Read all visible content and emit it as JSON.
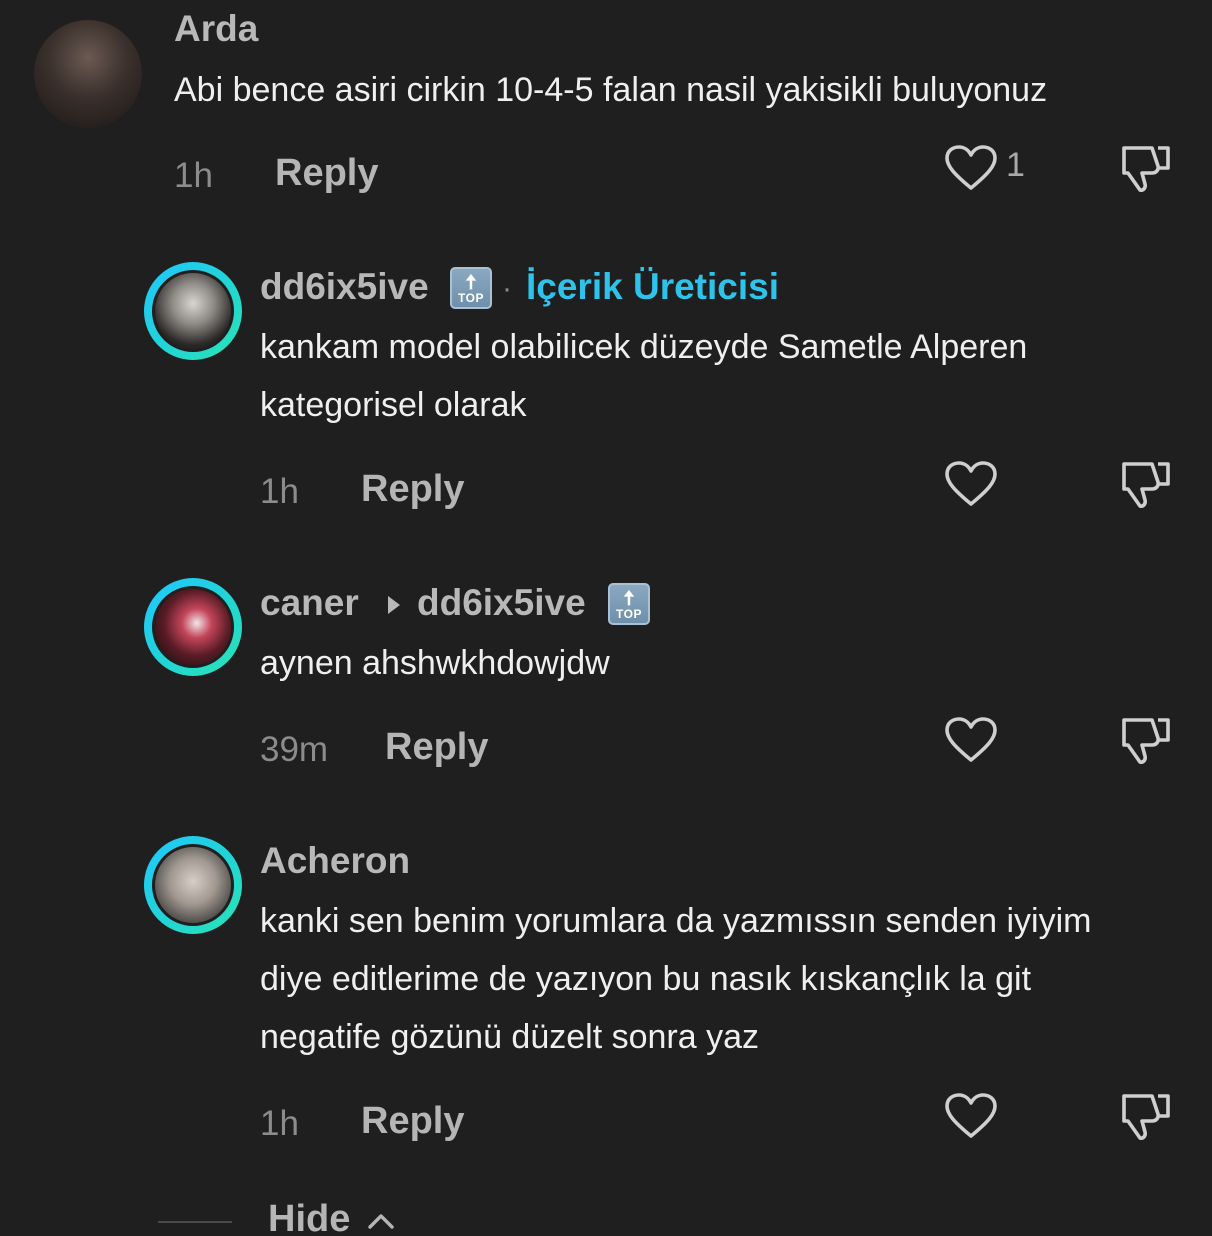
{
  "comments": [
    {
      "username": "Arda",
      "text": "Abi bence asiri cirkin 10-4-5 falan nasil yakisikli buluyonuz",
      "time": "1h",
      "reply_label": "Reply",
      "like_count": "1"
    },
    {
      "username": "dd6ix5ive",
      "badge": "İçerik Üreticisi",
      "separator": "·",
      "text": "kankam model olabilicek düzeyde Sametle Alperen\nkategorisel olarak",
      "time": "1h",
      "reply_label": "Reply"
    },
    {
      "username": "caner",
      "reply_to": "dd6ix5ive",
      "text": "aynen ahshwkhdowjdw",
      "time": "39m",
      "reply_label": "Reply"
    },
    {
      "username": "Acheron",
      "text": "kanki sen benim yorumlara da yazmıssın senden iyiyim\ndiye editlerime de yazıyon bu nasık kıskançlık la git\nnegatife gözünü düzelt sonra yaz",
      "time": "1h",
      "reply_label": "Reply"
    }
  ],
  "top_badge_text": "TOP",
  "top_badge_arrow": "🠅",
  "hide_label": "Hide",
  "colors": {
    "background": "#1f1f1f",
    "creator_badge": "#2ec3ea",
    "ring_start": "#1ec8ff",
    "ring_end": "#29e4b3"
  }
}
